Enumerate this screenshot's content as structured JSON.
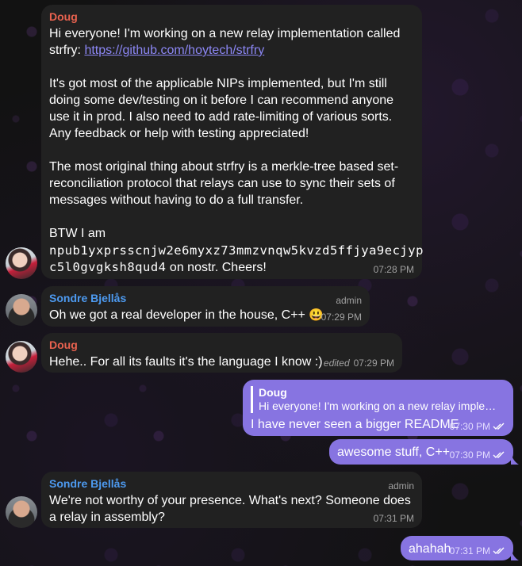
{
  "messages": {
    "m1": {
      "sender": "Doug",
      "p1_text": "Hi everyone! I'm working on a new relay implementation called strfry: ",
      "p1_link": "https://github.com/hoytech/strfry",
      "p2": "It's got most of the applicable NIPs implemented, but I'm still doing some dev/testing on it before I can recommend anyone use it in prod. I also need to add rate-limiting of various sorts. Any feedback or help with testing appreciated!",
      "p3": "The most original thing about strfry is a merkle-tree based set-reconciliation protocol that relays can use to sync their sets of messages without having to do a full transfer.",
      "p4_prefix": "BTW I am",
      "p4_npub_line1": "npub1yxprsscnjw2e6myxz73mmzvnqw5kvzd5ffjya9ecjyp",
      "p4_npub_line2": "c5l0gvgksh8qud4",
      "p4_suffix": " on nostr. Cheers!",
      "time": "07:28 PM"
    },
    "m2": {
      "sender": "Sondre Bjellås",
      "role": "admin",
      "text": "Oh we got a real developer in the house, C++ ",
      "emoji": "😃",
      "time": "07:29 PM"
    },
    "m3": {
      "sender": "Doug",
      "text": "Hehe.. For all its faults it's the language I know :)",
      "edited": "edited",
      "time": "07:29 PM"
    },
    "m4": {
      "reply_name": "Doug",
      "reply_text": "Hi everyone! I'm working on a new relay implem…",
      "text": "I have never seen a bigger README",
      "time": "07:30 PM"
    },
    "m5": {
      "text": "awesome stuff, C++",
      "time": "07:30 PM"
    },
    "m6": {
      "sender": "Sondre Bjellås",
      "role": "admin",
      "text": "We're not worthy of your presence. What's next? Someone does a relay in assembly?",
      "time": "07:31 PM"
    },
    "m7": {
      "text": "ahahah",
      "time": "07:31 PM"
    }
  },
  "colors": {
    "incoming": "#212121",
    "outgoing": "#8774e1",
    "doug": "#e9624f",
    "sondre": "#4d9af0",
    "link": "#8c87f5"
  }
}
